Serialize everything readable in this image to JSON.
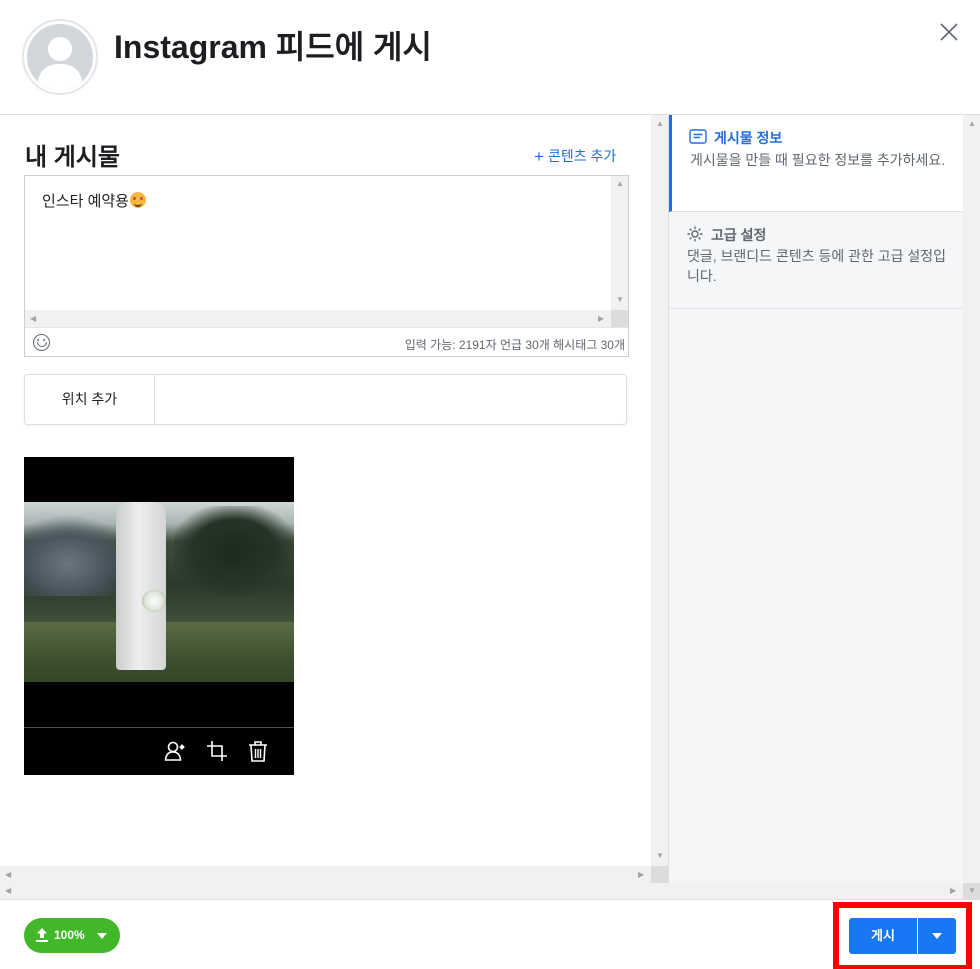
{
  "header": {
    "title": "Instagram 피드에 게시"
  },
  "post": {
    "section_title": "내 게시물",
    "add_content_label": "콘텐츠 추가",
    "caption_text": "인스타 예약용",
    "caption_emoji": "smiling-face-with-hearts-emoji",
    "counts_text": "입력 가능: 2191자 언급 30개 해시태그 30개",
    "location_label": "위치 추가",
    "location_value": "",
    "media_tools": [
      "tag-people-icon",
      "crop-icon",
      "trash-icon"
    ]
  },
  "side_panel": {
    "sections": [
      {
        "title": "게시물 정보",
        "description": "게시물을 만들 때 필요한 정보를 추가하세요.",
        "icon": "post-info-icon",
        "active": true
      },
      {
        "title": "고급 설정",
        "description": "댓글, 브랜디드 콘텐츠 등에 관한 고급 설정입니다.",
        "icon": "gear-icon",
        "active": false
      }
    ]
  },
  "footer": {
    "upload_progress_label": "100%",
    "upload_progress": 1.0,
    "publish_label": "게시"
  },
  "colors": {
    "accent_blue": "#1877f2",
    "link_blue": "#216fdb",
    "upload_green": "#42b72a",
    "highlight_red": "#ff0000"
  }
}
